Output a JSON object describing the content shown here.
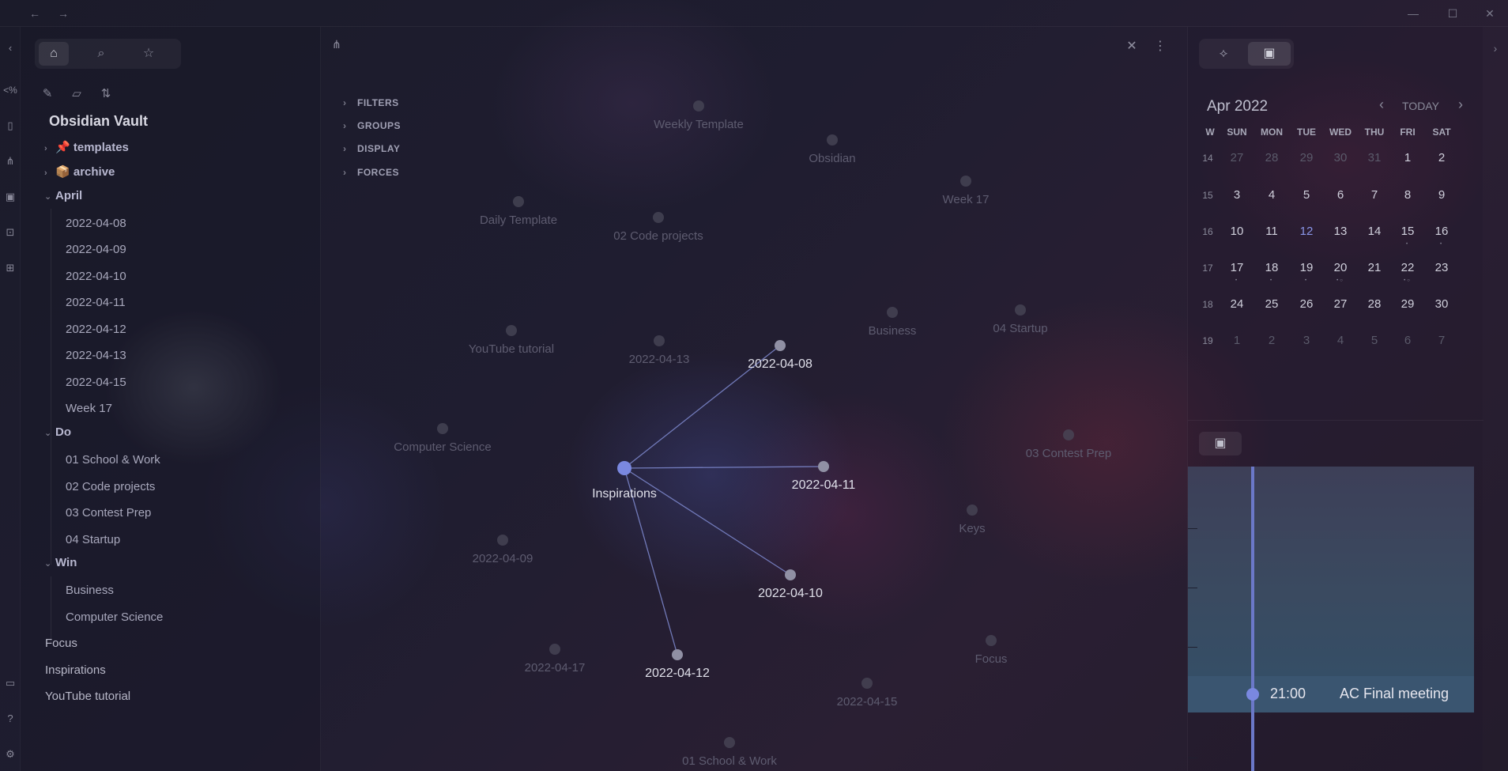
{
  "titlebar": {
    "back_icon": "arrow-left-icon",
    "forward_icon": "arrow-right-icon",
    "minimize_icon": "minimize-icon",
    "maximize_icon": "maximize-icon",
    "close_icon": "close-icon"
  },
  "ribbon": {
    "icons": [
      "collapse-left-icon",
      "templater-icon",
      "file-search-icon",
      "graph-icon",
      "calendar-check-icon",
      "terminal-icon",
      "grid-icon",
      "vault-switch-icon",
      "help-icon",
      "settings-icon"
    ],
    "templater_glyph": "<%"
  },
  "sidebar": {
    "tabs": [
      "home-icon",
      "search-icon",
      "star-icon"
    ],
    "actions": [
      "new-note-icon",
      "new-folder-icon",
      "sort-icon"
    ],
    "vault_title": "Obsidian Vault",
    "tree": [
      {
        "label": "templates",
        "type": "folder",
        "collapsed": true,
        "emoji": "📌"
      },
      {
        "label": "archive",
        "type": "folder",
        "collapsed": true,
        "emoji": "📦"
      },
      {
        "label": "April",
        "type": "folder",
        "collapsed": false
      },
      {
        "label": "2022-04-08",
        "type": "file",
        "depth": 1
      },
      {
        "label": "2022-04-09",
        "type": "file",
        "depth": 1
      },
      {
        "label": "2022-04-10",
        "type": "file",
        "depth": 1
      },
      {
        "label": "2022-04-11",
        "type": "file",
        "depth": 1
      },
      {
        "label": "2022-04-12",
        "type": "file",
        "depth": 1
      },
      {
        "label": "2022-04-13",
        "type": "file",
        "depth": 1
      },
      {
        "label": "2022-04-15",
        "type": "file",
        "depth": 1
      },
      {
        "label": "Week 17",
        "type": "file",
        "depth": 1
      },
      {
        "label": "Do",
        "type": "folder",
        "collapsed": false
      },
      {
        "label": "01 School & Work",
        "type": "file",
        "depth": 1
      },
      {
        "label": "02 Code projects",
        "type": "file",
        "depth": 1
      },
      {
        "label": "03 Contest Prep",
        "type": "file",
        "depth": 1
      },
      {
        "label": "04 Startup",
        "type": "file",
        "depth": 1
      },
      {
        "label": "Win",
        "type": "folder",
        "collapsed": false
      },
      {
        "label": "Business",
        "type": "file",
        "depth": 1
      },
      {
        "label": "Computer Science",
        "type": "file",
        "depth": 1
      },
      {
        "label": "Focus",
        "type": "file",
        "depth": 0
      },
      {
        "label": "Inspirations",
        "type": "file",
        "depth": 0
      },
      {
        "label": "YouTube tutorial",
        "type": "file",
        "depth": 0
      }
    ]
  },
  "graph": {
    "head_icon": "graph-icon",
    "close_icon": "close-icon",
    "more_icon": "more-vertical-icon",
    "settings": [
      "FILTERS",
      "GROUPS",
      "DISPLAY",
      "FORCES"
    ],
    "center_node": "Inspirations",
    "linked_nodes": [
      "2022-04-08",
      "2022-04-11",
      "2022-04-10",
      "2022-04-12"
    ],
    "faded_nodes": [
      "Weekly Template",
      "Obsidian",
      "Week 17",
      "Daily Template",
      "02 Code projects",
      "YouTube tutorial",
      "2022-04-13",
      "Business",
      "04 Startup",
      "Computer Science",
      "03 Contest Prep",
      "Keys",
      "2022-04-09",
      "2022-04-17",
      "Focus",
      "2022-04-15",
      "01 School & Work"
    ],
    "accent": "#7a88e0",
    "link_color": "#7f8ad0"
  },
  "right_panel": {
    "tabs": [
      "graph-sparkle-icon",
      "calendar-check-icon"
    ],
    "calendar": {
      "month": "Apr 2022",
      "today_label": "TODAY",
      "prev_icon": "chevron-left-icon",
      "next_icon": "chevron-right-icon",
      "week_header": "W",
      "days": [
        "SUN",
        "MON",
        "TUE",
        "WED",
        "THU",
        "FRI",
        "SAT"
      ],
      "weeks": [
        {
          "w": "14",
          "d": [
            "27",
            "28",
            "29",
            "30",
            "31",
            "1",
            "2"
          ]
        },
        {
          "w": "15",
          "d": [
            "3",
            "4",
            "5",
            "6",
            "7",
            "8",
            "9"
          ]
        },
        {
          "w": "16",
          "d": [
            "10",
            "11",
            "12",
            "13",
            "14",
            "15",
            "16"
          ]
        },
        {
          "w": "17",
          "d": [
            "17",
            "18",
            "19",
            "20",
            "21",
            "22",
            "23"
          ]
        },
        {
          "w": "18",
          "d": [
            "24",
            "25",
            "26",
            "27",
            "28",
            "29",
            "30"
          ]
        },
        {
          "w": "19",
          "d": [
            "1",
            "2",
            "3",
            "4",
            "5",
            "6",
            "7"
          ]
        }
      ],
      "today": "12",
      "today_color": "#8a95e8"
    },
    "timeline": {
      "tab_icon": "calendar-check-icon",
      "event_time": "21:00",
      "event_title": "AC Final meeting"
    }
  }
}
